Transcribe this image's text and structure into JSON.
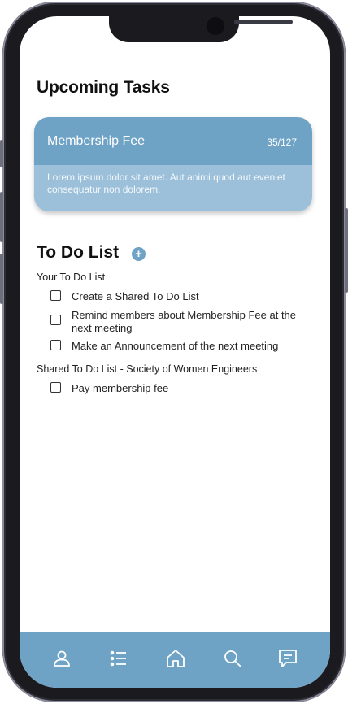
{
  "upcoming": {
    "title": "Upcoming Tasks",
    "card": {
      "name": "Membership Fee",
      "count": "35/127",
      "description": "Lorem ipsum dolor sit amet. Aut animi quod aut eveniet consequatur non dolorem."
    }
  },
  "todo": {
    "title": "To Do List",
    "add_icon": "plus-circle-icon",
    "sections": [
      {
        "label": "Your To Do List",
        "tasks": [
          "Create a Shared To Do List",
          "Remind members about Membership Fee at the next meeting",
          "Make an Announcement of the next meeting"
        ]
      },
      {
        "label": "Shared To Do List - Society of Women Engineers",
        "tasks": [
          "Pay membership fee"
        ]
      }
    ]
  },
  "nav": {
    "items": [
      "profile-icon",
      "list-icon",
      "home-icon",
      "search-icon",
      "chat-icon"
    ]
  },
  "colors": {
    "accent": "#6fa3c6",
    "card_light": "#9cc0da"
  }
}
